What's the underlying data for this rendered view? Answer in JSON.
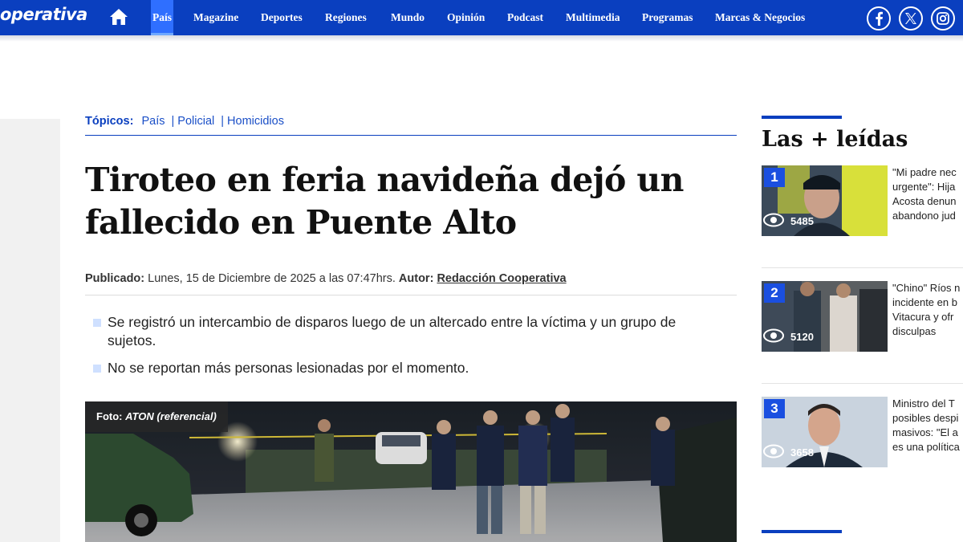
{
  "brand": {
    "logo_text": "operativa"
  },
  "nav": {
    "items": [
      "País",
      "Magazine",
      "Deportes",
      "Regiones",
      "Mundo",
      "Opinión",
      "Podcast",
      "Multimedia",
      "Programas",
      "Marcas & Negocios"
    ],
    "active": "País"
  },
  "social": [
    "facebook",
    "x",
    "instagram"
  ],
  "topics": {
    "label": "Tópicos:",
    "items": [
      "País",
      "| Policial",
      "| Homicidios"
    ]
  },
  "article": {
    "title": "Tiroteo en feria navideña dejó un fallecido en Puente Alto",
    "published_label": "Publicado:",
    "published_value": "Lunes, 15 de Diciembre de 2025 a las 07:47hrs.",
    "author_label": "Autor:",
    "author_value": "Redacción Cooperativa",
    "bullets": [
      "Se registró un intercambio de disparos luego de un altercado entre la víctima y un grupo de sujetos.",
      "No se reportan más personas lesionadas por el momento."
    ],
    "photo_credit_label": "Foto:",
    "photo_credit_value": "ATON (referencial)"
  },
  "sidebar": {
    "title": "Las + leídas",
    "items": [
      {
        "rank": "1",
        "views": "5485",
        "lines": [
          "\"Mi padre nec",
          "urgente\": Hija",
          "Acosta denun",
          "abandono jud"
        ]
      },
      {
        "rank": "2",
        "views": "5120",
        "lines": [
          "\"Chino\" Ríos n",
          "incidente en b",
          "Vitacura y ofr",
          "disculpas"
        ]
      },
      {
        "rank": "3",
        "views": "3658",
        "lines": [
          "Ministro del T",
          "posibles despi",
          "masivos: \"El a",
          "es una política"
        ]
      }
    ]
  },
  "colors": {
    "brand_blue": "#0a3fbf",
    "link_blue": "#1a4fc7",
    "active_tab": "#2f6fff"
  }
}
